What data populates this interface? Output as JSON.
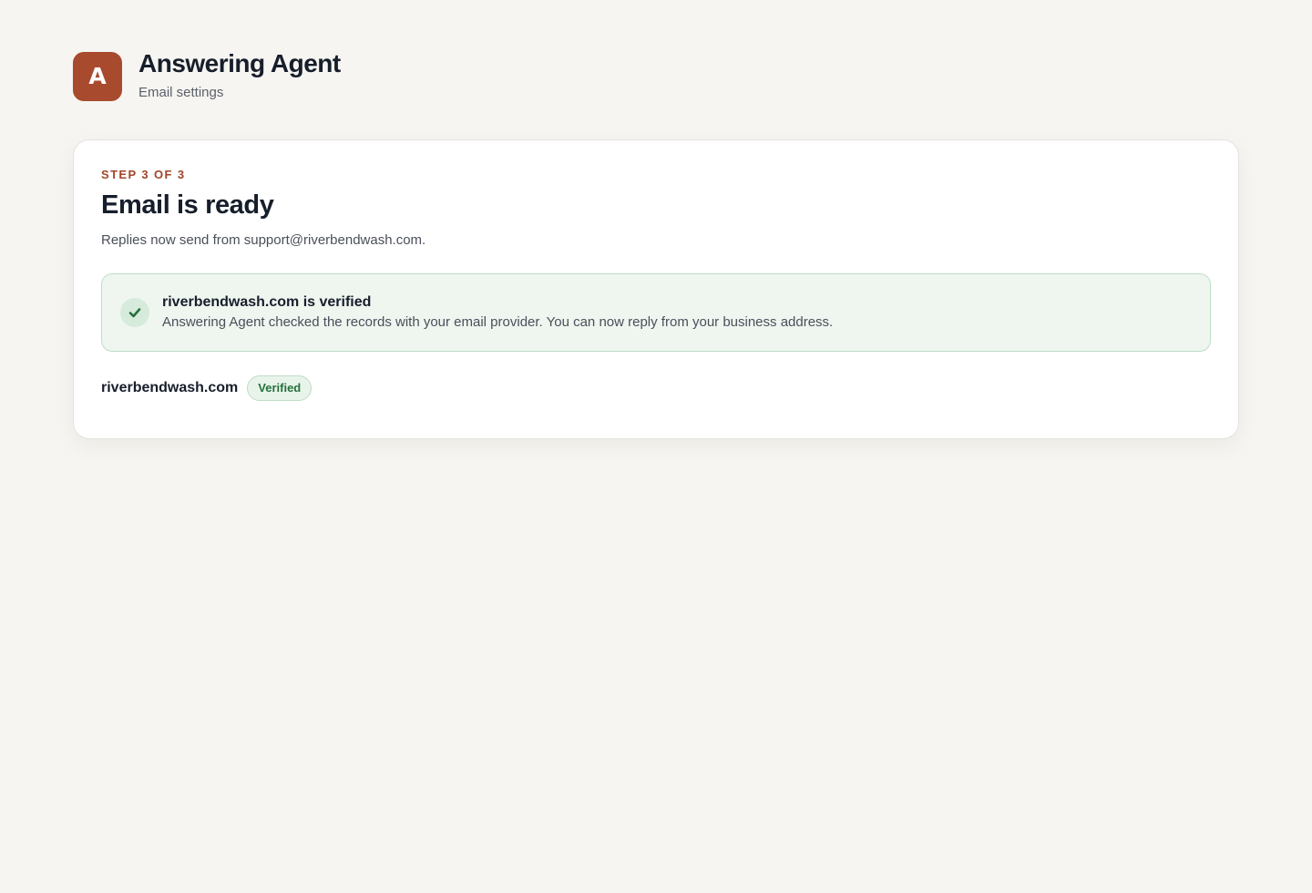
{
  "app": {
    "logo_letter": "A",
    "title": "Answering Agent",
    "subtitle": "Email settings"
  },
  "card": {
    "step_label": "STEP 3 OF 3",
    "title": "Email is ready",
    "description": "Replies now send from support@riverbendwash.com."
  },
  "success": {
    "icon": "check-icon",
    "title": "riverbendwash.com is verified",
    "body": "Answering Agent checked the records with your email provider. You can now reply from your business address."
  },
  "domain": {
    "name": "riverbendwash.com",
    "status": "Verified"
  },
  "colors": {
    "brand": "#a84a2e",
    "success": "#25713e",
    "success_bg": "#eff6f0",
    "background": "#f6f5f1"
  }
}
